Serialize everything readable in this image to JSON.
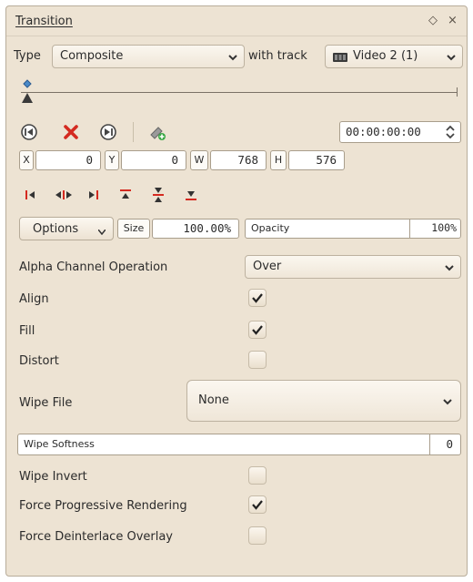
{
  "window": {
    "title": "Transition",
    "float_glyph": "◇",
    "close_glyph": "×"
  },
  "type_row": {
    "type_label": "Type",
    "type_value": "Composite",
    "with_track_label": "with track",
    "track_value": "Video 2 (1)"
  },
  "timecode": "00:00:00:00",
  "geometry": {
    "x_label": "X",
    "x_value": "0",
    "y_label": "Y",
    "y_value": "0",
    "w_label": "W",
    "w_value": "768",
    "h_label": "H",
    "h_value": "576"
  },
  "options_row": {
    "options_label": "Options",
    "size_label": "Size",
    "size_value": "100.00%",
    "opacity_label": "Opacity",
    "opacity_value": "100%"
  },
  "params": {
    "alpha_label": "Alpha Channel Operation",
    "alpha_value": "Over",
    "align_label": "Align",
    "align_checked": true,
    "fill_label": "Fill",
    "fill_checked": true,
    "distort_label": "Distort",
    "distort_checked": false,
    "wipe_file_label": "Wipe File",
    "wipe_file_value": "None",
    "wipe_softness_label": "Wipe Softness",
    "wipe_softness_value": "0",
    "wipe_invert_label": "Wipe Invert",
    "wipe_invert_checked": false,
    "force_prog_label": "Force Progressive Rendering",
    "force_prog_checked": true,
    "force_deint_label": "Force Deinterlace Overlay",
    "force_deint_checked": false
  },
  "icons": {
    "prev": "previous-keyframe-icon",
    "delete": "delete-keyframe-icon",
    "next": "next-keyframe-icon",
    "add": "add-keyframe-icon",
    "align": [
      "align-left-icon",
      "align-hcenter-icon",
      "align-right-icon",
      "align-top-icon",
      "align-vcenter-icon",
      "align-bottom-icon"
    ]
  },
  "colors": {
    "panel_bg": "#ede3d3",
    "accent_red": "#d42a20",
    "text": "#2b2b2b"
  }
}
